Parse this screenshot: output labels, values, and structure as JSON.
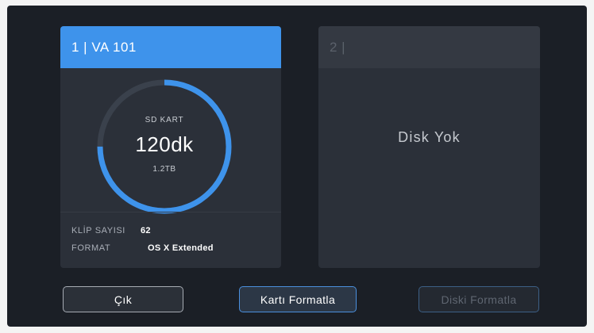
{
  "slots": [
    {
      "header": "1 | VA 101",
      "storage_label": "SD KART",
      "remaining_time": "120dk",
      "capacity": "1.2TB",
      "ring_fill_fraction": 0.75,
      "clip_count_label": "KLİP SAYISI",
      "clip_count_value": "62",
      "format_label": "FORMAT",
      "format_value": "OS X Extended"
    },
    {
      "header": "2 |",
      "status": "Disk Yok"
    }
  ],
  "buttons": {
    "exit": "Çık",
    "format_card": "Kartı Formatla",
    "format_disk": "Diski Formatla"
  },
  "colors": {
    "accent": "#3e93eb",
    "screen_background": "#1b1f26",
    "card_background": "#2b3039"
  }
}
